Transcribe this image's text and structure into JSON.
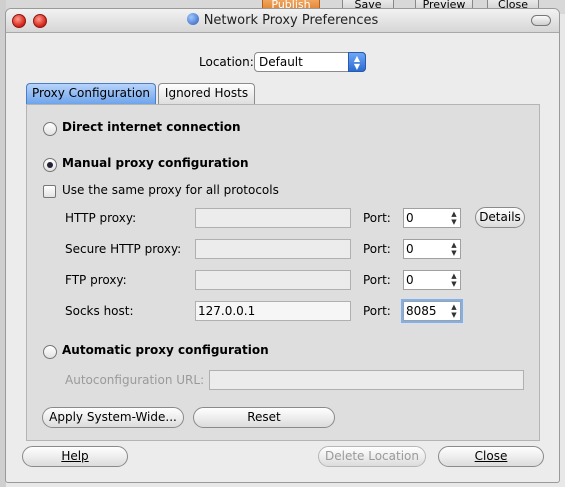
{
  "background": {
    "buttons": [
      "Publish",
      "Save",
      "Preview",
      "Close"
    ]
  },
  "window": {
    "title": "Network Proxy Preferences"
  },
  "location": {
    "label": "Location:",
    "selected": "Default"
  },
  "tabs": [
    {
      "label": "Proxy Configuration",
      "active": true
    },
    {
      "label": "Ignored Hosts",
      "active": false
    }
  ],
  "proxy": {
    "direct_label": "Direct internet connection",
    "manual_label": "Manual proxy configuration",
    "same_proxy_label": "Use the same proxy for all protocols",
    "port_label": "Port:",
    "rows": [
      {
        "label": "HTTP proxy:",
        "host": "",
        "port": "0"
      },
      {
        "label": "Secure HTTP proxy:",
        "host": "",
        "port": "0"
      },
      {
        "label": "FTP proxy:",
        "host": "",
        "port": "0"
      },
      {
        "label": "Socks host:",
        "host": "127.0.0.1",
        "port": "8085"
      }
    ],
    "details_label": "Details",
    "auto_label": "Automatic proxy configuration",
    "autoconfig_label": "Autoconfiguration URL:",
    "autoconfig_value": ""
  },
  "actions": {
    "apply_label": "Apply System-Wide...",
    "reset_label": "Reset"
  },
  "footer": {
    "help_label": "Help",
    "delete_label": "Delete Location",
    "close_label": "Close"
  }
}
